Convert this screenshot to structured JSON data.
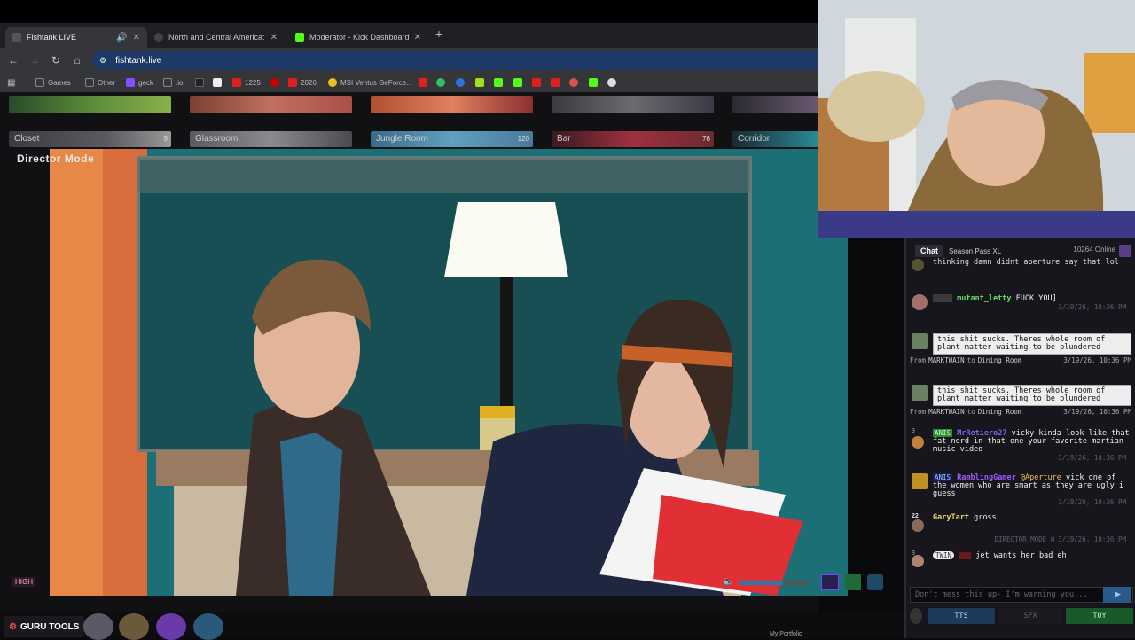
{
  "browser": {
    "tabs": [
      {
        "label": "Fishtank LIVE",
        "active": true
      },
      {
        "label": "North and Central America: Co",
        "active": false
      },
      {
        "label": "Moderator - Kick Dashboard",
        "active": false
      }
    ],
    "url": "fishtank.live",
    "bookmarks": [
      {
        "label": "Games"
      },
      {
        "label": "Other"
      },
      {
        "label": "geck"
      },
      {
        "label": ".io"
      },
      {
        "label": "1225"
      },
      {
        "label": "2026"
      },
      {
        "label": "MSI Ventus GeForce..."
      }
    ]
  },
  "site": {
    "rooms": [
      {
        "label": "Closet",
        "count": "9"
      },
      {
        "label": "Glassroom",
        "count": ""
      },
      {
        "label": "Jungle Room",
        "count": "120"
      },
      {
        "label": "Bar",
        "count": "76"
      },
      {
        "label": "Corridor",
        "count": ""
      }
    ],
    "director_label": "Director Mode",
    "quality": "HIGH",
    "guru_label": "GURU TOOLS",
    "footer_label": "My Portfolio"
  },
  "chat": {
    "tab_chat": "Chat",
    "tab_season": "Season Pass XL",
    "online": "10264 Online",
    "messages": [
      {
        "kind": "text",
        "user": "",
        "text": "thinking damn didnt aperture say that lol",
        "time": ""
      },
      {
        "kind": "text",
        "badge": "",
        "user": "mutant_letty",
        "user_color": "#5fe05f",
        "text": "FUCK YOU]",
        "time": "3/19/26, 10:36 PM"
      },
      {
        "kind": "tts",
        "text": "this shit sucks. Theres whole room of plant matter waiting to be plundered",
        "from_label": "From",
        "from": "MARKTWAIN",
        "to_label": "to",
        "room": "Dining Room",
        "time": "3/19/26, 10:36 PM"
      },
      {
        "kind": "tts",
        "text": "this shit sucks. Theres whole room of plant matter waiting to be plundered",
        "from_label": "From",
        "from": "MARKTWAIN",
        "to_label": "to",
        "room": "Dining Room",
        "time": "3/19/26, 10:36 PM"
      },
      {
        "kind": "text",
        "level": "3",
        "badge": "ANIS",
        "user": "MrRetiero27",
        "user_color": "#6b6bf0",
        "text": "vicky kinda look like that fat nerd in that one your favorite martian music video",
        "time": "3/19/26, 10:36 PM"
      },
      {
        "kind": "text",
        "badge": "ANIS",
        "user": "RamblingGamer",
        "user_color": "#9a5bff",
        "mention": "@Aperture",
        "text": "vick one of the women who are smart as they are ugly i guess",
        "time": "3/19/26, 10:36 PM"
      },
      {
        "kind": "text",
        "level": "22",
        "user": "GaryTart",
        "user_color": "#e8d36a",
        "text": "gross",
        "time": ""
      },
      {
        "kind": "system",
        "text": "DIRECTOR MODE @",
        "time": "3/19/26, 10:36 PM"
      },
      {
        "kind": "text",
        "level": "3",
        "badge": "TWIN",
        "user": "",
        "text": "jet wants her bad eh",
        "time": ""
      }
    ],
    "input_placeholder": "Don't mess this up- I'm warning you...",
    "footer": {
      "tts": "TTS",
      "sfx": "SFX",
      "toy": "TOY"
    }
  }
}
